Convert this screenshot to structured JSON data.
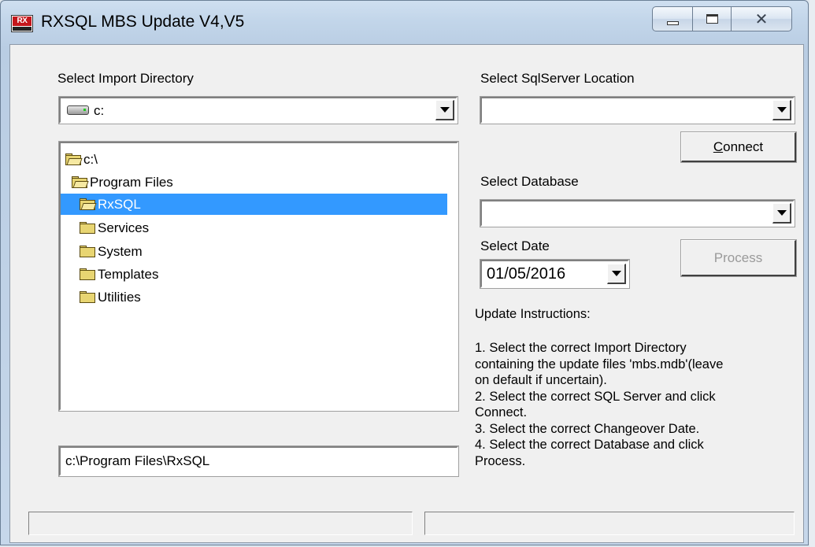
{
  "window": {
    "title": "RXSQL MBS Update V4,V5",
    "icon_text": "RX"
  },
  "left": {
    "import_dir_label": "Select Import Directory",
    "drive_value": "c:",
    "directories": [
      {
        "label": "c:\\",
        "state": "open"
      },
      {
        "label": "Program Files",
        "state": "open"
      },
      {
        "label": "RxSQL",
        "state": "selected"
      },
      {
        "label": "Services",
        "state": "closed"
      },
      {
        "label": "System",
        "state": "closed"
      },
      {
        "label": "Templates",
        "state": "closed"
      },
      {
        "label": "Utilities",
        "state": "closed"
      }
    ],
    "path_value": "c:\\Program Files\\RxSQL"
  },
  "right": {
    "sqlserver_label": "Select SqlServer Location",
    "sqlserver_value": "",
    "connect_button": "Connect",
    "database_label": "Select Database",
    "database_value": "",
    "date_label": "Select Date",
    "date_value": "01/05/2016",
    "process_button": "Process",
    "instructions_title": "Update Instructions:",
    "instructions_lines": [
      "1. Select the correct Import Directory",
      "containing the update files 'mbs.mdb'(leave",
      "on default if uncertain).",
      "2. Select the correct SQL Server and click",
      "Connect.",
      "3. Select the correct Changeover Date.",
      "4. Select the correct Database and click",
      "Process."
    ]
  },
  "status_bar": {
    "left_text": "",
    "right_text": ""
  }
}
